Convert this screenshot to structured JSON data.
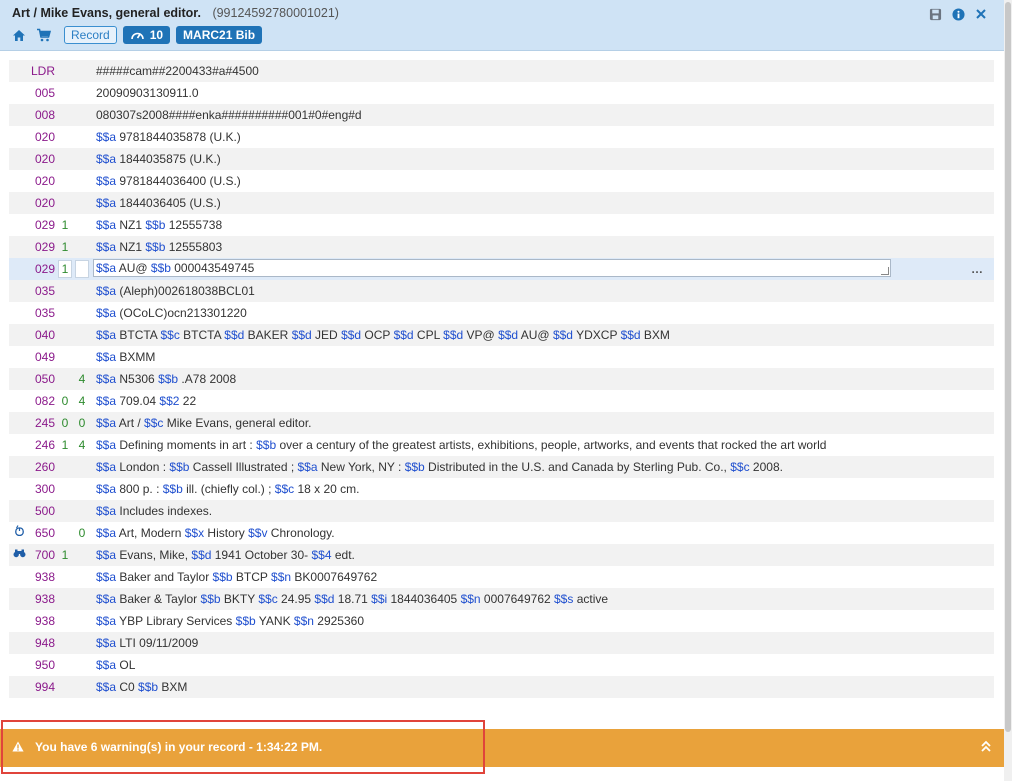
{
  "header": {
    "title": "Art / Mike Evans, general editor.",
    "mms_id": "(99124592780001021)",
    "record_label": "Record",
    "counter": "10",
    "format_label": "MARC21 Bib"
  },
  "rows": [
    {
      "tag": "LDR",
      "i1": "",
      "i2": "",
      "segments": [
        [
          "t",
          "#####cam##2200433#a#4500"
        ]
      ]
    },
    {
      "tag": "005",
      "i1": "",
      "i2": "",
      "segments": [
        [
          "t",
          "20090903130911.0"
        ]
      ]
    },
    {
      "tag": "008",
      "i1": "",
      "i2": "",
      "segments": [
        [
          "t",
          "080307s2008####enka##########001#0#eng#d"
        ]
      ]
    },
    {
      "tag": "020",
      "i1": "",
      "i2": "",
      "segments": [
        [
          "s",
          "$$a"
        ],
        [
          "t",
          " 9781844035878 (U.K.)"
        ]
      ]
    },
    {
      "tag": "020",
      "i1": "",
      "i2": "",
      "segments": [
        [
          "s",
          "$$a"
        ],
        [
          "t",
          " 1844035875 (U.K.)"
        ]
      ]
    },
    {
      "tag": "020",
      "i1": "",
      "i2": "",
      "segments": [
        [
          "s",
          "$$a"
        ],
        [
          "t",
          " 9781844036400 (U.S.)"
        ]
      ]
    },
    {
      "tag": "020",
      "i1": "",
      "i2": "",
      "segments": [
        [
          "s",
          "$$a"
        ],
        [
          "t",
          " 1844036405 (U.S.)"
        ]
      ]
    },
    {
      "tag": "029",
      "i1": "1",
      "i2": "",
      "segments": [
        [
          "s",
          "$$a"
        ],
        [
          "t",
          " NZ1 "
        ],
        [
          "s",
          "$$b"
        ],
        [
          "t",
          " 12555738"
        ]
      ]
    },
    {
      "tag": "029",
      "i1": "1",
      "i2": "",
      "segments": [
        [
          "s",
          "$$a"
        ],
        [
          "t",
          " NZ1 "
        ],
        [
          "s",
          "$$b"
        ],
        [
          "t",
          " 12555803"
        ]
      ]
    },
    {
      "tag": "029",
      "i1": "1",
      "i2": "",
      "active": true,
      "segments": [
        [
          "s",
          "$$a"
        ],
        [
          "t",
          " AU@ "
        ],
        [
          "s",
          "$$b"
        ],
        [
          "t",
          " 000043549745"
        ]
      ]
    },
    {
      "tag": "035",
      "i1": "",
      "i2": "",
      "segments": [
        [
          "s",
          "$$a"
        ],
        [
          "t",
          " (Aleph)002618038BCL01"
        ]
      ]
    },
    {
      "tag": "035",
      "i1": "",
      "i2": "",
      "segments": [
        [
          "s",
          "$$a"
        ],
        [
          "t",
          " (OCoLC)ocn213301220"
        ]
      ]
    },
    {
      "tag": "040",
      "i1": "",
      "i2": "",
      "segments": [
        [
          "s",
          "$$a"
        ],
        [
          "t",
          " BTCTA "
        ],
        [
          "s",
          "$$c"
        ],
        [
          "t",
          " BTCTA "
        ],
        [
          "s",
          "$$d"
        ],
        [
          "t",
          " BAKER "
        ],
        [
          "s",
          "$$d"
        ],
        [
          "t",
          " JED "
        ],
        [
          "s",
          "$$d"
        ],
        [
          "t",
          " OCP "
        ],
        [
          "s",
          "$$d"
        ],
        [
          "t",
          " CPL "
        ],
        [
          "s",
          "$$d"
        ],
        [
          "t",
          " VP@ "
        ],
        [
          "s",
          "$$d"
        ],
        [
          "t",
          " AU@ "
        ],
        [
          "s",
          "$$d"
        ],
        [
          "t",
          " YDXCP "
        ],
        [
          "s",
          "$$d"
        ],
        [
          "t",
          " BXM"
        ]
      ]
    },
    {
      "tag": "049",
      "i1": "",
      "i2": "",
      "segments": [
        [
          "s",
          "$$a"
        ],
        [
          "t",
          " BXMM"
        ]
      ]
    },
    {
      "tag": "050",
      "i1": "",
      "i2": "4",
      "segments": [
        [
          "s",
          "$$a"
        ],
        [
          "t",
          " N5306 "
        ],
        [
          "s",
          "$$b"
        ],
        [
          "t",
          " .A78 2008"
        ]
      ]
    },
    {
      "tag": "082",
      "i1": "0",
      "i2": "4",
      "segments": [
        [
          "s",
          "$$a"
        ],
        [
          "t",
          " 709.04 "
        ],
        [
          "s",
          "$$2"
        ],
        [
          "t",
          " 22"
        ]
      ]
    },
    {
      "tag": "245",
      "i1": "0",
      "i2": "0",
      "segments": [
        [
          "s",
          "$$a"
        ],
        [
          "t",
          " Art / "
        ],
        [
          "s",
          "$$c"
        ],
        [
          "t",
          " Mike Evans, general editor."
        ]
      ]
    },
    {
      "tag": "246",
      "i1": "1",
      "i2": "4",
      "segments": [
        [
          "s",
          "$$a"
        ],
        [
          "t",
          " Defining moments in art : "
        ],
        [
          "s",
          "$$b"
        ],
        [
          "t",
          " over a century of the greatest artists, exhibitions, people, artworks, and events that rocked the art world"
        ]
      ]
    },
    {
      "tag": "260",
      "i1": "",
      "i2": "",
      "segments": [
        [
          "s",
          "$$a"
        ],
        [
          "t",
          " London : "
        ],
        [
          "s",
          "$$b"
        ],
        [
          "t",
          " Cassell Illustrated ; "
        ],
        [
          "s",
          "$$a"
        ],
        [
          "t",
          " New York, NY : "
        ],
        [
          "s",
          "$$b"
        ],
        [
          "t",
          " Distributed in the U.S. and Canada by Sterling Pub. Co., "
        ],
        [
          "s",
          "$$c"
        ],
        [
          "t",
          " 2008."
        ]
      ]
    },
    {
      "tag": "300",
      "i1": "",
      "i2": "",
      "segments": [
        [
          "s",
          "$$a"
        ],
        [
          "t",
          " 800 p. : "
        ],
        [
          "s",
          "$$b"
        ],
        [
          "t",
          " ill. (chiefly col.) ; "
        ],
        [
          "s",
          "$$c"
        ],
        [
          "t",
          " 18 x 20 cm."
        ]
      ]
    },
    {
      "tag": "500",
      "i1": "",
      "i2": "",
      "segments": [
        [
          "s",
          "$$a"
        ],
        [
          "t",
          " Includes indexes."
        ]
      ]
    },
    {
      "tag": "650",
      "i1": "",
      "i2": "0",
      "mark": "mouse-icon",
      "segments": [
        [
          "s",
          "$$a"
        ],
        [
          "t",
          " Art, Modern "
        ],
        [
          "s",
          "$$x"
        ],
        [
          "t",
          " History "
        ],
        [
          "s",
          "$$v"
        ],
        [
          "t",
          " Chronology."
        ]
      ]
    },
    {
      "tag": "700",
      "i1": "1",
      "i2": "",
      "mark": "binoculars-icon",
      "segments": [
        [
          "s",
          "$$a"
        ],
        [
          "t",
          " Evans, Mike, "
        ],
        [
          "s",
          "$$d"
        ],
        [
          "t",
          " 1941 October 30- "
        ],
        [
          "s",
          "$$4"
        ],
        [
          "t",
          " edt."
        ]
      ]
    },
    {
      "tag": "938",
      "i1": "",
      "i2": "",
      "segments": [
        [
          "s",
          "$$a"
        ],
        [
          "t",
          " Baker and Taylor "
        ],
        [
          "s",
          "$$b"
        ],
        [
          "t",
          " BTCP "
        ],
        [
          "s",
          "$$n"
        ],
        [
          "t",
          " BK0007649762"
        ]
      ]
    },
    {
      "tag": "938",
      "i1": "",
      "i2": "",
      "segments": [
        [
          "s",
          "$$a"
        ],
        [
          "t",
          " Baker & Taylor "
        ],
        [
          "s",
          "$$b"
        ],
        [
          "t",
          " BKTY "
        ],
        [
          "s",
          "$$c"
        ],
        [
          "t",
          " 24.95 "
        ],
        [
          "s",
          "$$d"
        ],
        [
          "t",
          " 18.71 "
        ],
        [
          "s",
          "$$i"
        ],
        [
          "t",
          " 1844036405 "
        ],
        [
          "s",
          "$$n"
        ],
        [
          "t",
          " 0007649762 "
        ],
        [
          "s",
          "$$s"
        ],
        [
          "t",
          " active"
        ]
      ]
    },
    {
      "tag": "938",
      "i1": "",
      "i2": "",
      "segments": [
        [
          "s",
          "$$a"
        ],
        [
          "t",
          " YBP Library Services "
        ],
        [
          "s",
          "$$b"
        ],
        [
          "t",
          " YANK "
        ],
        [
          "s",
          "$$n"
        ],
        [
          "t",
          " 2925360"
        ]
      ]
    },
    {
      "tag": "948",
      "i1": "",
      "i2": "",
      "segments": [
        [
          "s",
          "$$a"
        ],
        [
          "t",
          " LTI 09/11/2009"
        ]
      ]
    },
    {
      "tag": "950",
      "i1": "",
      "i2": "",
      "segments": [
        [
          "s",
          "$$a"
        ],
        [
          "t",
          " OL"
        ]
      ]
    },
    {
      "tag": "994",
      "i1": "",
      "i2": "",
      "segments": [
        [
          "s",
          "$$a"
        ],
        [
          "t",
          " C0 "
        ],
        [
          "s",
          "$$b"
        ],
        [
          "t",
          " BXM"
        ]
      ]
    }
  ],
  "row_menu": "…",
  "warning": {
    "text": "You have 6 warning(s) in your record - 1:34:22 PM."
  },
  "colors": {
    "header_bg": "#cfe3f5",
    "tag": "#8b1a8b",
    "indicator": "#2e8b2e",
    "subfield": "#1f4fcf",
    "warning_bg": "#e9a23b",
    "highlight_border": "#e0443b"
  }
}
